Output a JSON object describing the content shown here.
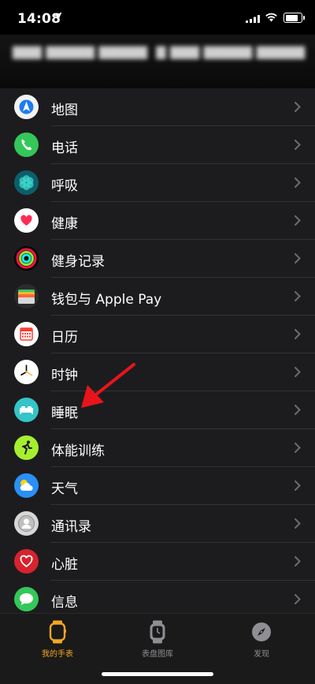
{
  "status_bar": {
    "time": "14:08"
  },
  "settings_list": [
    {
      "label": "地图",
      "icon": "maps-icon"
    },
    {
      "label": "电话",
      "icon": "phone-icon"
    },
    {
      "label": "呼吸",
      "icon": "breathe-icon"
    },
    {
      "label": "健康",
      "icon": "health-heart-icon"
    },
    {
      "label": "健身记录",
      "icon": "activity-rings-icon"
    },
    {
      "label": "钱包与 Apple Pay",
      "icon": "wallet-icon"
    },
    {
      "label": "日历",
      "icon": "calendar-icon"
    },
    {
      "label": "时钟",
      "icon": "clock-icon"
    },
    {
      "label": "睡眠",
      "icon": "sleep-bed-icon"
    },
    {
      "label": "体能训练",
      "icon": "workout-runner-icon"
    },
    {
      "label": "天气",
      "icon": "weather-icon"
    },
    {
      "label": "通讯录",
      "icon": "contacts-icon"
    },
    {
      "label": "心脏",
      "icon": "heart-icon"
    },
    {
      "label": "信息",
      "icon": "messages-icon"
    }
  ],
  "tab_bar": {
    "tabs": [
      {
        "label": "我的手表",
        "icon": "watch-icon",
        "active": true
      },
      {
        "label": "表盘图库",
        "icon": "face-gallery-icon",
        "active": false
      },
      {
        "label": "发现",
        "icon": "discover-compass-icon",
        "active": false
      }
    ]
  },
  "colors": {
    "accent": "#f5a623",
    "list_bg": "#1c1c1e",
    "annotation_arrow": "#e8141c"
  }
}
